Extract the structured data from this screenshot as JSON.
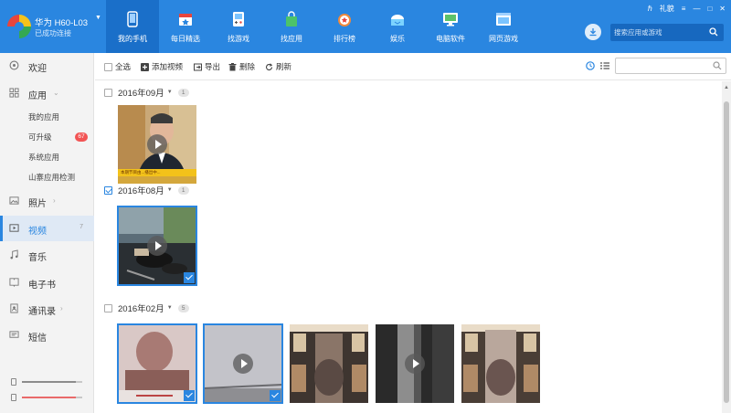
{
  "device": {
    "name": "华为 H60-L03",
    "status": "已成功连接"
  },
  "nav": [
    {
      "label": "我的手机",
      "icon": "phone-icon",
      "active": true
    },
    {
      "label": "每日精选",
      "icon": "calendar-star-icon"
    },
    {
      "label": "找游戏",
      "icon": "gamepad-icon"
    },
    {
      "label": "找应用",
      "icon": "bag-icon"
    },
    {
      "label": "排行榜",
      "icon": "medal-icon"
    },
    {
      "label": "娱乐",
      "icon": "entertainment-icon"
    },
    {
      "label": "电脑软件",
      "icon": "monitor-icon"
    },
    {
      "label": "网页游戏",
      "icon": "browser-icon"
    }
  ],
  "window": {
    "user_label": "礼貌"
  },
  "search": {
    "placeholder": "搜索应用或游戏"
  },
  "sidebar": {
    "items": [
      {
        "label": "欢迎",
        "icon": "welcome-icon"
      },
      {
        "label": "应用",
        "icon": "apps-grid-icon"
      },
      {
        "label": "照片",
        "icon": "photo-icon"
      },
      {
        "label": "视频",
        "icon": "video-icon",
        "count": "7",
        "active": true
      },
      {
        "label": "音乐",
        "icon": "music-icon"
      },
      {
        "label": "电子书",
        "icon": "book-icon"
      },
      {
        "label": "通讯录",
        "icon": "contacts-icon"
      },
      {
        "label": "短信",
        "icon": "message-icon"
      }
    ],
    "app_sub": [
      {
        "label": "我的应用"
      },
      {
        "label": "可升级",
        "badge": "67"
      },
      {
        "label": "系统应用"
      },
      {
        "label": "山寨应用检测"
      }
    ],
    "storage": [
      {
        "type": "phone",
        "used": 0.9,
        "color": "#8c8c8c"
      },
      {
        "type": "sdcard",
        "used": 0.9,
        "color": "#e96a6a"
      }
    ]
  },
  "toolbar": {
    "select_all": "全选",
    "add_video": "添加视频",
    "export": "导出",
    "delete": "删除",
    "refresh": "刷新"
  },
  "groups": [
    {
      "date": "2016年09月",
      "count": "1",
      "checked": false
    },
    {
      "date": "2016年08月",
      "count": "1",
      "checked": true
    },
    {
      "date": "2016年02月",
      "count": "5",
      "checked": false
    }
  ],
  "thumb_caption": "本期节目由...播出中..."
}
